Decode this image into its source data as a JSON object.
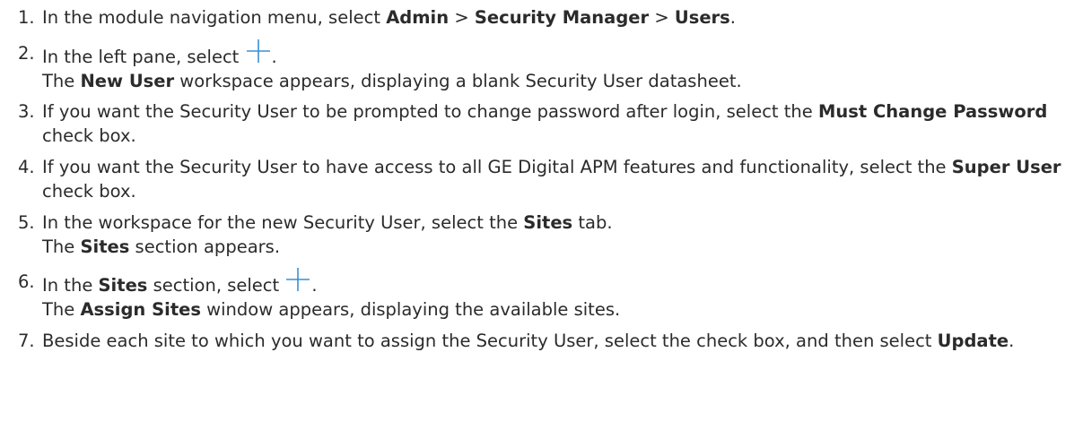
{
  "steps": [
    {
      "num": "1.",
      "a": "In the module navigation menu, select ",
      "b1": "Admin",
      "sep1": " > ",
      "b2": "Security Manager",
      "sep2": " > ",
      "b3": "Users",
      "end": "."
    },
    {
      "num": "2.",
      "a": "In the left pane, select ",
      "icon": "plus-icon",
      "end": ".",
      "r1": "The ",
      "rb": "New User",
      "r2": " workspace appears, displaying a blank Security User datasheet."
    },
    {
      "num": "3.",
      "a": "If you want the Security User to be prompted to change password after login, select the ",
      "b1": "Must Change Password",
      "end": " check box."
    },
    {
      "num": "4.",
      "a": "If you want the Security User to have access to all GE Digital APM features and functionality, select the ",
      "b1": "Super User",
      "end": " check box."
    },
    {
      "num": "5.",
      "a": "In the workspace for the new Security User, select the ",
      "b1": "Sites",
      "end": " tab.",
      "r1": "The ",
      "rb": "Sites",
      "r2": " section appears."
    },
    {
      "num": "6.",
      "a": "In the ",
      "b1": "Sites",
      "a2": " section, select ",
      "icon": "plus-icon",
      "end": ".",
      "r1": "The ",
      "rb": "Assign Sites",
      "r2": " window appears, displaying the available sites."
    },
    {
      "num": "7.",
      "a": "Beside each site to which you want to assign the Security User, select the check box, and then select ",
      "b1": "Update",
      "end": "."
    }
  ],
  "colors": {
    "text": "#2b2b2b",
    "icon": "#3a8fd6"
  }
}
